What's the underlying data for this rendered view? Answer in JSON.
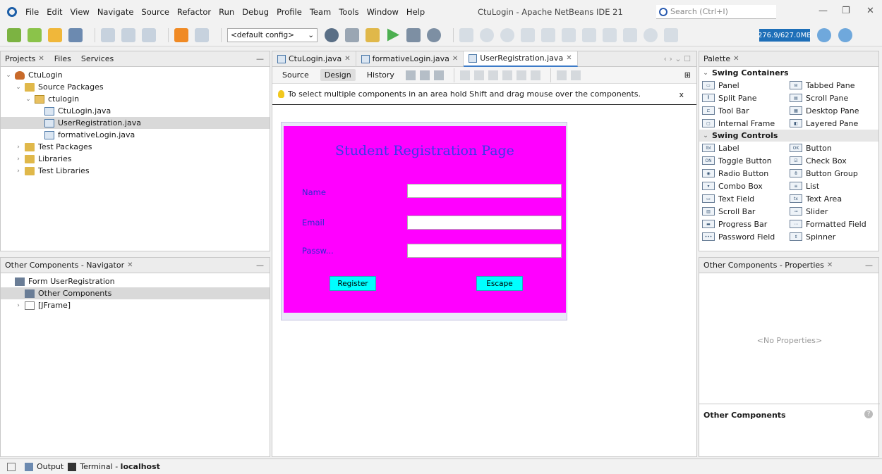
{
  "menu": {
    "items": [
      "File",
      "Edit",
      "View",
      "Navigate",
      "Source",
      "Refactor",
      "Run",
      "Debug",
      "Profile",
      "Team",
      "Tools",
      "Window",
      "Help"
    ],
    "window_title": "CtuLogin - Apache NetBeans IDE 21",
    "search_placeholder": "Search (Ctrl+I)"
  },
  "toolbar": {
    "config": "<default config>",
    "memory": "276.9/627.0MB"
  },
  "projects": {
    "tabs": [
      "Projects",
      "Files",
      "Services"
    ],
    "tree": [
      {
        "label": "CtuLogin",
        "indent": 0,
        "icon": "project",
        "chev": "⌄"
      },
      {
        "label": "Source Packages",
        "indent": 1,
        "icon": "folder",
        "chev": "⌄"
      },
      {
        "label": "ctulogin",
        "indent": 2,
        "icon": "package",
        "chev": "⌄"
      },
      {
        "label": "CtuLogin.java",
        "indent": 3,
        "icon": "java",
        "chev": ""
      },
      {
        "label": "UserRegistration.java",
        "indent": 3,
        "icon": "java",
        "chev": "",
        "selected": true
      },
      {
        "label": "formativeLogin.java",
        "indent": 3,
        "icon": "java",
        "chev": ""
      },
      {
        "label": "Test Packages",
        "indent": 1,
        "icon": "folder",
        "chev": "›"
      },
      {
        "label": "Libraries",
        "indent": 1,
        "icon": "folder",
        "chev": "›"
      },
      {
        "label": "Test Libraries",
        "indent": 1,
        "icon": "folder",
        "chev": "›"
      }
    ]
  },
  "navigator": {
    "title": "Other Components - Navigator",
    "tree": [
      {
        "label": "Form UserRegistration",
        "indent": 0,
        "icon": "form",
        "chev": ""
      },
      {
        "label": "Other Components",
        "indent": 1,
        "icon": "form",
        "chev": "",
        "selected": true
      },
      {
        "label": "[JFrame]",
        "indent": 1,
        "icon": "frame",
        "chev": "›"
      }
    ]
  },
  "editor": {
    "tabs": [
      {
        "label": "CtuLogin.java",
        "active": false
      },
      {
        "label": "formativeLogin.java",
        "active": false
      },
      {
        "label": "UserRegistration.java",
        "active": true
      }
    ],
    "design_tabs": [
      {
        "label": "Source",
        "active": false
      },
      {
        "label": "Design",
        "active": true
      },
      {
        "label": "History",
        "active": false
      }
    ],
    "hint": "To select multiple components in an area hold Shift and drag mouse over the components.",
    "hint_close": "x"
  },
  "form": {
    "title": "Student Registration Page",
    "name_label": "Name",
    "email_label": "Email",
    "password_label": "Passw...",
    "register_label": "Register",
    "escape_label": "Escape",
    "bg_color": "#ff00ff",
    "button_color": "#00ffff"
  },
  "palette": {
    "title": "Palette",
    "containers_head": "Swing Containers",
    "containers": [
      "Panel",
      "Tabbed Pane",
      "Split Pane",
      "Scroll Pane",
      "Tool Bar",
      "Desktop Pane",
      "Internal Frame",
      "Layered Pane"
    ],
    "controls_head": "Swing Controls",
    "controls": [
      "Label",
      "Button",
      "Toggle Button",
      "Check Box",
      "Radio Button",
      "Button Group",
      "Combo Box",
      "List",
      "Text Field",
      "Text Area",
      "Scroll Bar",
      "Slider",
      "Progress Bar",
      "Formatted Field",
      "Password Field",
      "Spinner"
    ]
  },
  "properties": {
    "title": "Other Components - Properties",
    "empty": "<No Properties>",
    "section": "Other Components"
  },
  "statusbar": {
    "output": "Output",
    "terminal_prefix": "Terminal - ",
    "terminal_host": "localhost"
  }
}
